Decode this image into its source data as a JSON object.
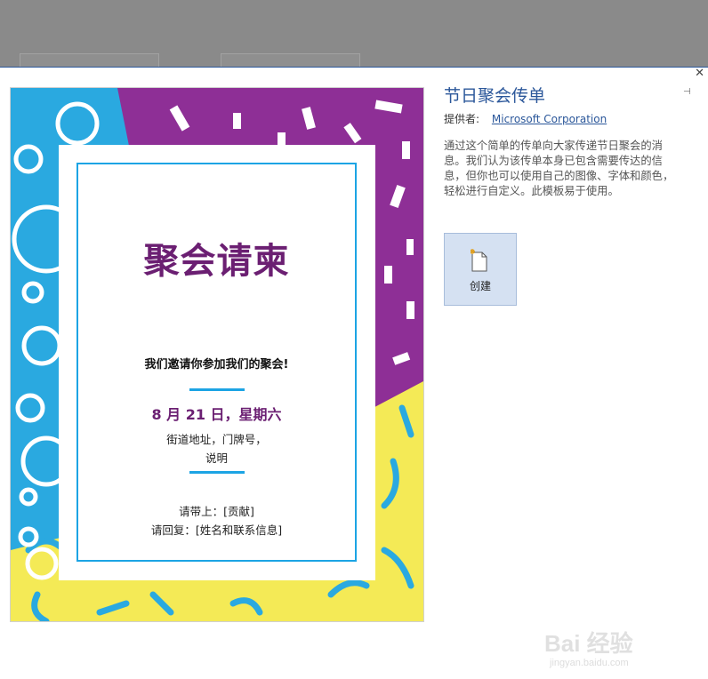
{
  "template": {
    "title": "节日聚会传单",
    "provider_label": "提供者:",
    "provider_name": "Microsoft Corporation",
    "description": "通过这个简单的传单向大家传递节日聚会的消息。我们认为该传单本身已包含需要传达的信息，但你也可以使用自己的图像、字体和颜色，轻松进行自定义。此模板易于使用。",
    "create_label": "创建"
  },
  "preview": {
    "heading": "聚会请柬",
    "invite": "我们邀请你参加我们的聚会!",
    "date": "8 月 21 日，星期六",
    "address_line1": "街道地址，门牌号，",
    "address_line2": "说明",
    "bring": "请带上：[贡献]",
    "rsvp": "请回复：[姓名和联系信息]"
  },
  "colors": {
    "accent": "#2b579a",
    "purple": "#8e2f96",
    "cyan": "#2aa9e0",
    "yellow": "#f4ea56"
  },
  "icons": {
    "close": "close-icon",
    "pin": "pin-icon",
    "create": "new-document-icon"
  },
  "watermark": {
    "text": "Bai 经验",
    "sub": "jingyan.baidu.com"
  }
}
